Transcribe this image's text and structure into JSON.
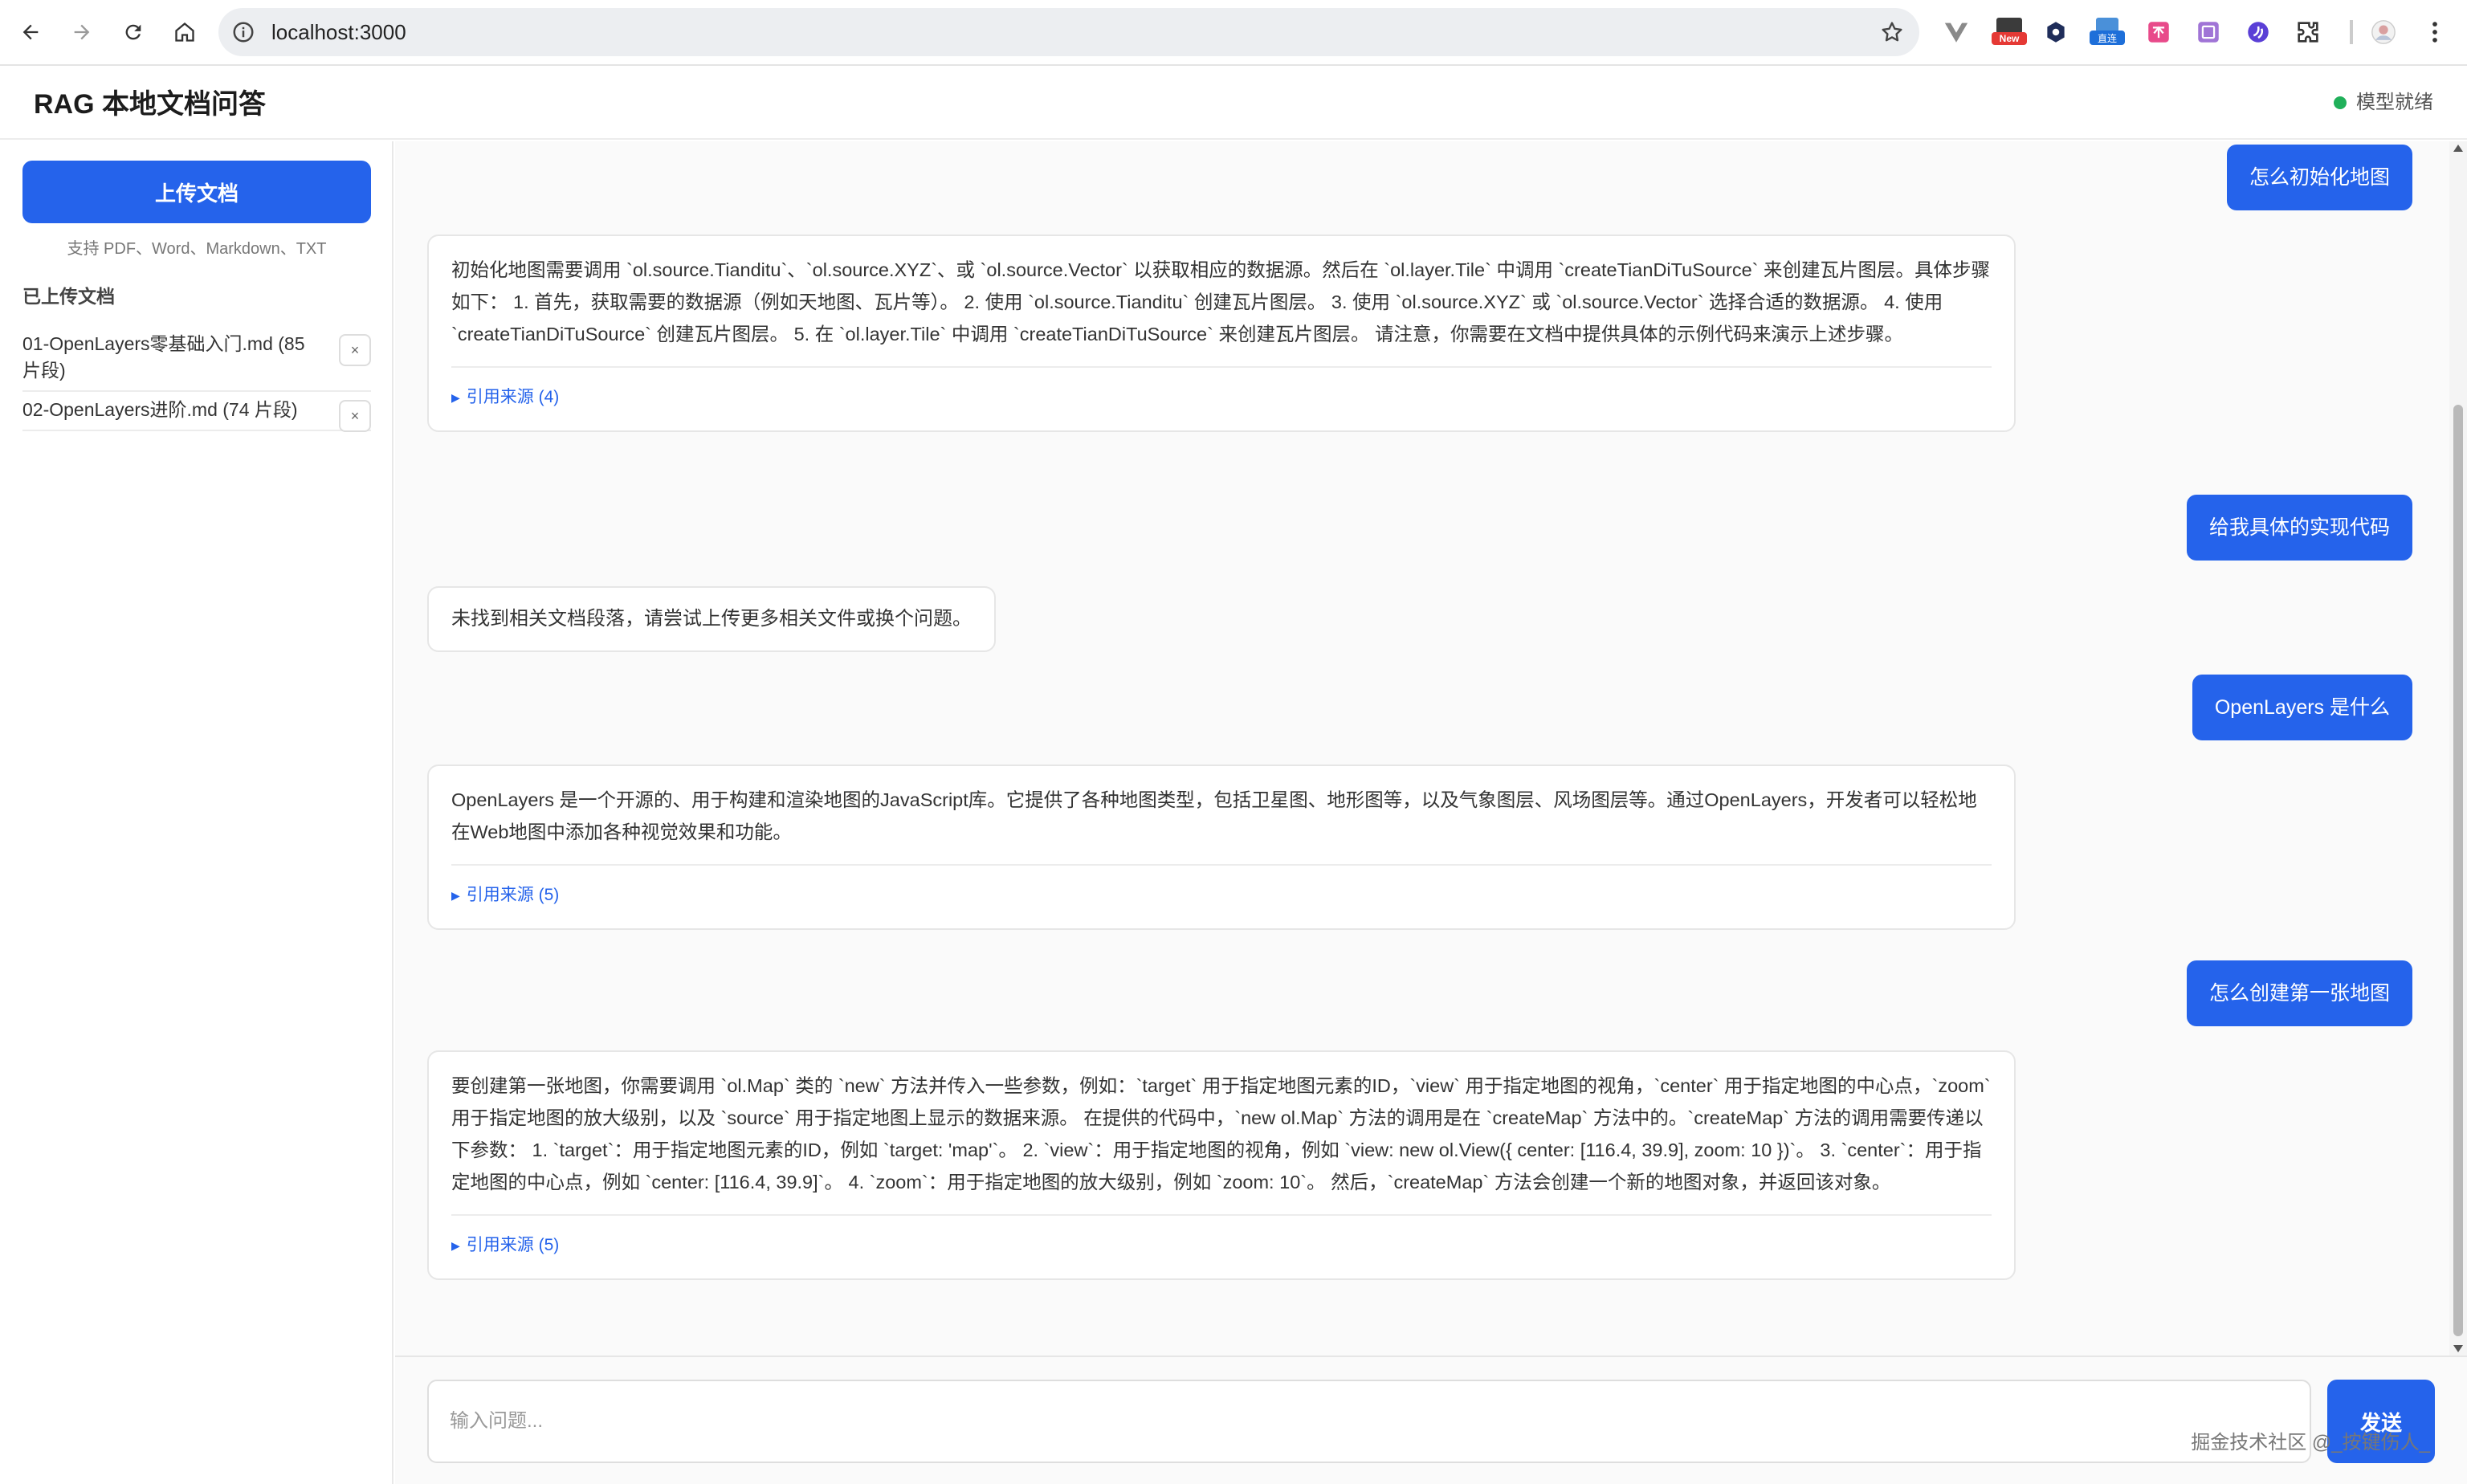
{
  "browser": {
    "url": "localhost:3000",
    "new_badge": "New",
    "direct_badge": "直连"
  },
  "header": {
    "title": "RAG 本地文档问答",
    "status": "模型就绪",
    "status_color": "#20b05a"
  },
  "sidebar": {
    "upload_label": "上传文档",
    "upload_hint": "支持 PDF、Word、Markdown、TXT",
    "docs_heading": "已上传文档",
    "docs": [
      {
        "name": "01-OpenLayers零基础入门.md (85 片段)",
        "remove": "×"
      },
      {
        "name": "02-OpenLayers进阶.md (74 片段)",
        "remove": "×"
      }
    ]
  },
  "chat": {
    "messages": [
      {
        "role": "user",
        "text": "怎么初始化地图"
      },
      {
        "role": "assistant",
        "text": "初始化地图需要调用 `ol.source.Tianditu`、`ol.source.XYZ`、或 `ol.source.Vector` 以获取相应的数据源。然后在 `ol.layer.Tile` 中调用 `createTianDiTuSource` 来创建瓦片图层。具体步骤如下： 1. 首先，获取需要的数据源（例如天地图、瓦片等）。 2. 使用 `ol.source.Tianditu` 创建瓦片图层。 3. 使用 `ol.source.XYZ` 或 `ol.source.Vector` 选择合适的数据源。 4. 使用 `createTianDiTuSource` 创建瓦片图层。 5. 在 `ol.layer.Tile` 中调用 `createTianDiTuSource` 来创建瓦片图层。 请注意，你需要在文档中提供具体的示例代码来演示上述步骤。",
        "sources": "引用来源 (4)"
      },
      {
        "role": "user",
        "text": "给我具体的实现代码"
      },
      {
        "role": "assistant",
        "text": "未找到相关文档段落，请尝试上传更多相关文件或换个问题。"
      },
      {
        "role": "user",
        "text": "OpenLayers 是什么"
      },
      {
        "role": "assistant",
        "text": "OpenLayers 是一个开源的、用于构建和渲染地图的JavaScript库。它提供了各种地图类型，包括卫星图、地形图等，以及气象图层、风场图层等。通过OpenLayers，开发者可以轻松地在Web地图中添加各种视觉效果和功能。",
        "sources": "引用来源 (5)"
      },
      {
        "role": "user",
        "text": "怎么创建第一张地图"
      },
      {
        "role": "assistant",
        "text": "要创建第一张地图，你需要调用 `ol.Map` 类的 `new` 方法并传入一些参数，例如：`target` 用于指定地图元素的ID，`view` 用于指定地图的视角，`center` 用于指定地图的中心点，`zoom` 用于指定地图的放大级别，以及 `source` 用于指定地图上显示的数据来源。 在提供的代码中，`new ol.Map` 方法的调用是在 `createMap` 方法中的。`createMap` 方法的调用需要传递以下参数： 1. `target`：用于指定地图元素的ID，例如 `target: 'map'`。 2. `view`：用于指定地图的视角，例如 `view: new ol.View({ center: [116.4, 39.9], zoom: 10 })`。 3. `center`：用于指定地图的中心点，例如 `center: [116.4, 39.9]`。 4. `zoom`：用于指定地图的放大级别，例如 `zoom: 10`。 然后，`createMap` 方法会创建一个新的地图对象，并返回该对象。",
        "sources": "引用来源 (5)"
      }
    ]
  },
  "input": {
    "placeholder": "输入问题...",
    "send_label": "发送"
  },
  "watermark": "掘金技术社区 @_按键伤人_",
  "colors": {
    "accent": "#2563eb",
    "status_ok": "#20b05a"
  }
}
